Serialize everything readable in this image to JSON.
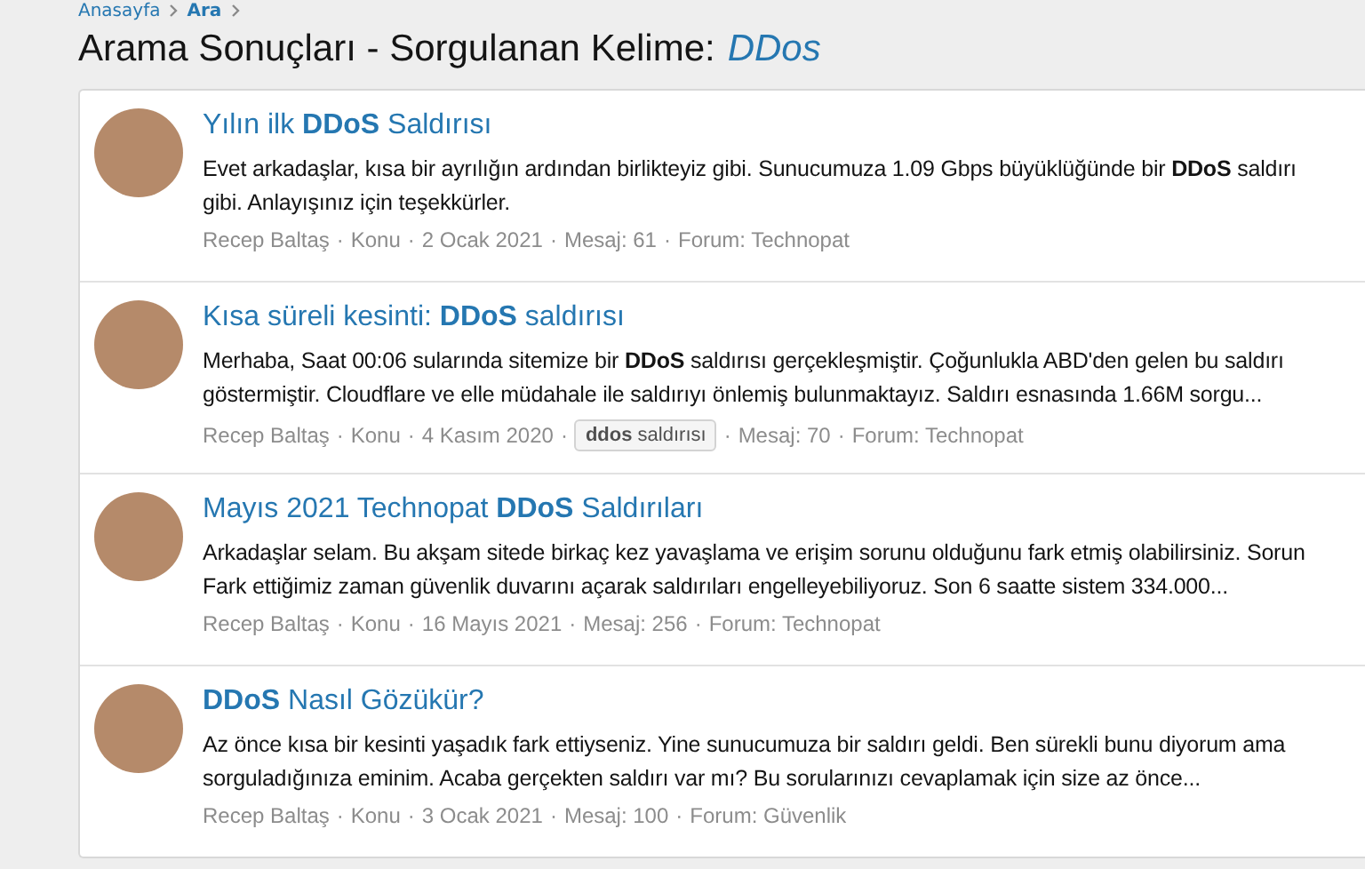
{
  "breadcrumb": [
    "Anasayfa",
    "Ara"
  ],
  "meta_separator": "·",
  "heading": {
    "text": "Arama Sonuçları - Sorgulanan Kelime:",
    "query": "DDos"
  },
  "results": [
    {
      "title": "Yılın ilk **DDoS** Saldırısı",
      "snippet": [
        "Evet arkadaşlar, kısa bir ayrılığın ardından birlikteyiz gibi. Sunucumuza 1.09 Gbps büyüklüğünde bir **DDoS** saldırı",
        "gibi. Anlayışınız için teşekkürler."
      ],
      "meta": [
        {
          "kind": "text",
          "text": "Recep Baltaş"
        },
        {
          "kind": "text",
          "text": "Konu"
        },
        {
          "kind": "text",
          "text": "2 Ocak 2021"
        },
        {
          "kind": "text",
          "text": "Mesaj: 61"
        },
        {
          "kind": "text",
          "text": "Forum: Technopat"
        }
      ]
    },
    {
      "title": "Kısa süreli kesinti: **DDoS** saldırısı",
      "snippet": [
        "Merhaba, Saat 00:06 sularında sitemize bir **DDoS** saldırısı gerçekleşmiştir. Çoğunlukla ABD'den gelen bu saldırı",
        "göstermiştir. Cloudflare ve elle müdahale ile saldırıyı önlemiş bulunmaktayız. Saldırı esnasında 1.66M sorgu..."
      ],
      "meta": [
        {
          "kind": "text",
          "text": "Recep Baltaş"
        },
        {
          "kind": "text",
          "text": "Konu"
        },
        {
          "kind": "text",
          "text": "4 Kasım 2020"
        },
        {
          "kind": "tag",
          "text": "**ddos** saldırısı"
        },
        {
          "kind": "text",
          "text": "Mesaj: 70"
        },
        {
          "kind": "text",
          "text": "Forum: Technopat"
        }
      ]
    },
    {
      "title": "Mayıs 2021 Technopat **DDoS** Saldırıları",
      "snippet": [
        "Arkadaşlar selam. Bu akşam sitede birkaç kez yavaşlama ve erişim sorunu olduğunu fark etmiş olabilirsiniz. Sorun",
        "Fark ettiğimiz zaman güvenlik duvarını açarak saldırıları engelleyebiliyoruz. Son 6 saatte sistem 334.000..."
      ],
      "meta": [
        {
          "kind": "text",
          "text": "Recep Baltaş"
        },
        {
          "kind": "text",
          "text": "Konu"
        },
        {
          "kind": "text",
          "text": "16 Mayıs 2021"
        },
        {
          "kind": "text",
          "text": "Mesaj: 256"
        },
        {
          "kind": "text",
          "text": "Forum: Technopat"
        }
      ]
    },
    {
      "title": "**DDoS** Nasıl Gözükür?",
      "snippet": [
        "Az önce kısa bir kesinti yaşadık fark ettiyseniz. Yine sunucumuza bir saldırı geldi. Ben sürekli bunu diyorum ama",
        "sorguladığınıza eminim. Acaba gerçekten saldırı var mı? Bu sorularınızı cevaplamak için size az önce..."
      ],
      "meta": [
        {
          "kind": "text",
          "text": "Recep Baltaş"
        },
        {
          "kind": "text",
          "text": "Konu"
        },
        {
          "kind": "text",
          "text": "3 Ocak 2021"
        },
        {
          "kind": "text",
          "text": "Mesaj: 100"
        },
        {
          "kind": "text",
          "text": "Forum: Güvenlik"
        }
      ]
    }
  ]
}
